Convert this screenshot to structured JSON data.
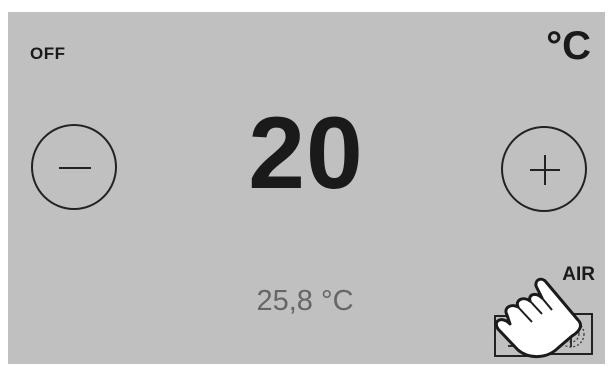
{
  "status": {
    "power": "OFF",
    "unit": "°C"
  },
  "controls": {
    "decrease_icon": "minus-icon",
    "increase_icon": "plus-icon"
  },
  "temperature": {
    "setpoint": "20",
    "current": "25,8 °C"
  },
  "mode": {
    "label": "AIR",
    "buttons": [
      {
        "icon": "list-icon"
      },
      {
        "icon": "air-mode-icon"
      }
    ]
  },
  "overlay": {
    "pointer_icon": "pointing-hand-icon"
  }
}
